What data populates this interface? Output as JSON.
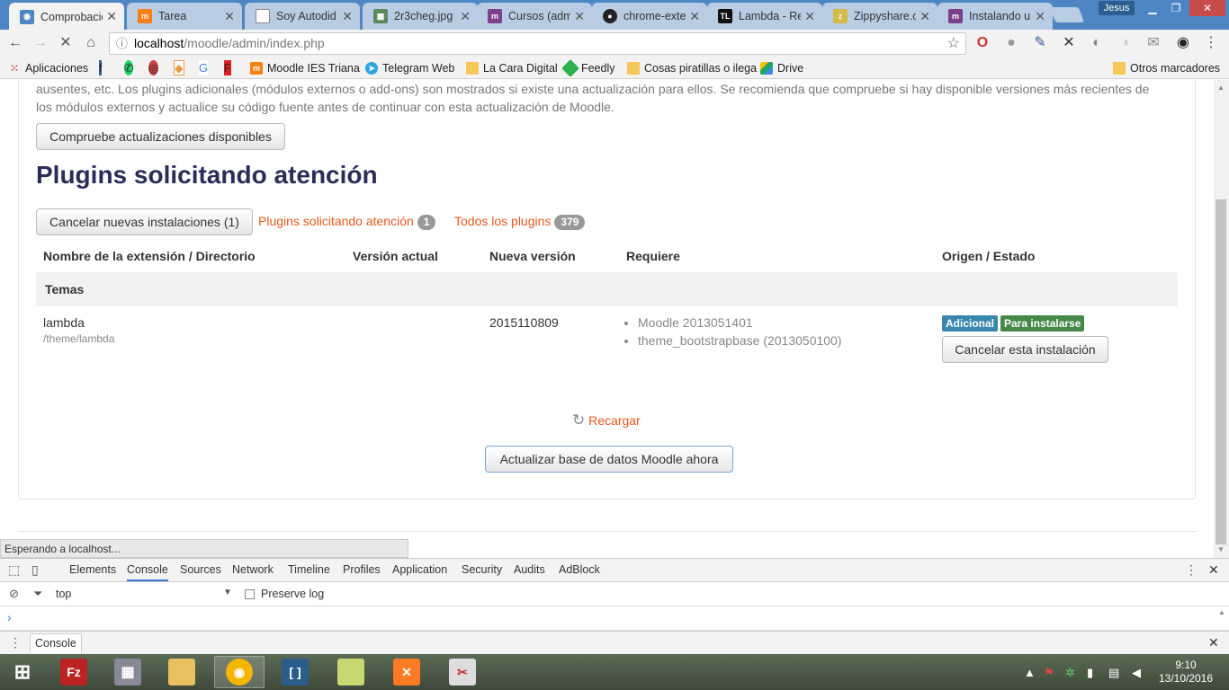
{
  "tabs": [
    {
      "title": "Comprobación",
      "favicon": "globe-icon",
      "color": "#4d86c2",
      "active": true
    },
    {
      "title": "Tarea",
      "favicon": "moodle-icon",
      "color": "#f98012",
      "active": false
    },
    {
      "title": "Soy Autodid",
      "favicon": "page-icon",
      "color": "#888888",
      "active": false
    },
    {
      "title": "2r3cheg.jpg",
      "favicon": "image-icon",
      "color": "#5a8a5a",
      "active": false
    },
    {
      "title": "Cursos (adm",
      "favicon": "moodle-m-icon",
      "color": "#7b3f8c",
      "active": false
    },
    {
      "title": "chrome-exte",
      "favicon": "extension-icon",
      "color": "#222222",
      "active": false
    },
    {
      "title": "Lambda - Re",
      "favicon": "tl-icon",
      "color": "#111111",
      "active": false
    },
    {
      "title": "Zippyshare.c",
      "favicon": "zippy-icon",
      "color": "#d4b84a",
      "active": false
    },
    {
      "title": "Instalando u",
      "favicon": "moodle-m-icon",
      "color": "#7b3f8c",
      "active": false
    }
  ],
  "window": {
    "user": "Jesus"
  },
  "address": {
    "host": "localhost",
    "path": "/moodle/admin/index.php"
  },
  "bookmarks": {
    "apps": "Aplicaciones",
    "items": [
      {
        "label": "Moodle IES Triana",
        "icon": "moodle-icon",
        "color": "#f98012"
      },
      {
        "label": "Telegram Web",
        "icon": "telegram-icon",
        "color": "#2ca5e0"
      },
      {
        "label": "La Cara Digital",
        "icon": "folder-icon",
        "color": "#f6c85a"
      },
      {
        "label": "Feedly",
        "icon": "feedly-icon",
        "color": "#2bb24c"
      },
      {
        "label": "Cosas piratillas o ilega",
        "icon": "folder-icon",
        "color": "#f6c85a"
      },
      {
        "label": "Drive",
        "icon": "drive-icon",
        "color": "#1fa463"
      }
    ],
    "other": "Otros marcadores"
  },
  "page": {
    "intro_line1": "ausentes, etc. Los plugins adicionales (módulos externos o add-ons) son mostrados si existe una actualización para ellos. Se recomienda que compruebe si hay disponible versiones más recientes de",
    "intro_line2": "los módulos externos y actualice su código fuente antes de continuar con esta actualización de Moodle.",
    "check_updates_button": "Compruebe actualizaciones disponibles",
    "title": "Plugins solicitando atención",
    "cancel_new_button": "Cancelar nuevas instalaciones (1)",
    "filter_attention": "Plugins solicitando atención",
    "filter_attention_count": "1",
    "filter_all": "Todos los plugins",
    "filter_all_count": "379",
    "table": {
      "headers": [
        "Nombre de la extensión / Directorio",
        "Versión actual",
        "Nueva versión",
        "Requiere",
        "Origen / Estado"
      ],
      "group": "Temas",
      "row": {
        "name": "lambda",
        "dir": "/theme/lambda",
        "current_version": "",
        "new_version": "2015110809",
        "requires": [
          "Moodle 2013051401",
          "theme_bootstrapbase (2013050100)"
        ],
        "label_source": "Adicional",
        "label_status": "Para instalarse",
        "cancel_button": "Cancelar esta instalación"
      }
    },
    "reload": "Recargar",
    "upgrade_button": "Actualizar base de datos Moodle ahora"
  },
  "status_bar": "Esperando a localhost...",
  "devtools": {
    "tabs": [
      "Elements",
      "Console",
      "Sources",
      "Network",
      "Timeline",
      "Profiles",
      "Application",
      "Security",
      "Audits",
      "AdBlock"
    ],
    "active_tab": "Console",
    "context": "top",
    "preserve_log": "Preserve log",
    "drawer_tab": "Console"
  },
  "clock": {
    "time": "9:10",
    "date": "13/10/2016"
  },
  "colors": {
    "accent_link": "#e8561b",
    "heading": "#2b2d59",
    "label_info": "#3a87ad",
    "label_success": "#468847"
  }
}
